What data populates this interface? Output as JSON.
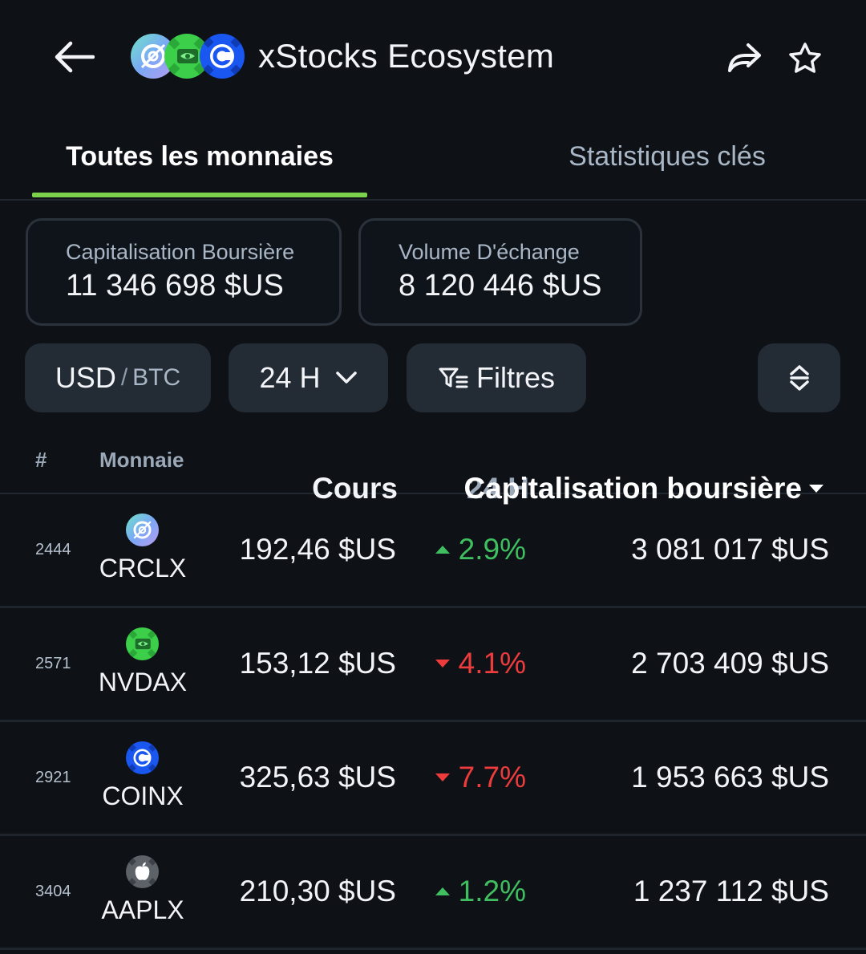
{
  "header": {
    "title": "xStocks Ecosystem",
    "logos": [
      "crclx-logo",
      "nvdax-logo",
      "coinx-logo"
    ],
    "icons": {
      "back": "arrow-left-icon",
      "share": "share-icon",
      "favorite": "star-icon"
    }
  },
  "tabs": [
    {
      "label": "Toutes les monnaies",
      "active": true
    },
    {
      "label": "Statistiques clés",
      "active": false
    }
  ],
  "stats": {
    "market_cap": {
      "label": "Capitalisation Boursière",
      "value": "11 346 698 $US"
    },
    "volume": {
      "label": "Volume D'échange",
      "value": "8 120 446 $US"
    }
  },
  "controls": {
    "currency": {
      "primary": "USD",
      "separator": "/",
      "secondary": "BTC"
    },
    "period": {
      "label": "24 H"
    },
    "filters": {
      "label": "Filtres"
    },
    "sort_icon": "sort-up-down-icon"
  },
  "table": {
    "headers": {
      "rank": "#",
      "coin": "Monnaie",
      "price": "Cours",
      "change": "24 H",
      "market_cap": "Capitalisation boursière"
    },
    "rows": [
      {
        "rank": "2444",
        "symbol": "CRCLX",
        "price": "192,46 $US",
        "change": "2.9%",
        "direction": "up",
        "market_cap": "3 081 017 $US"
      },
      {
        "rank": "2571",
        "symbol": "NVDAX",
        "price": "153,12 $US",
        "change": "4.1%",
        "direction": "down",
        "market_cap": "2 703 409 $US"
      },
      {
        "rank": "2921",
        "symbol": "COINX",
        "price": "325,63 $US",
        "change": "7.7%",
        "direction": "down",
        "market_cap": "1 953 663 $US"
      },
      {
        "rank": "3404",
        "symbol": "AAPLX",
        "price": "210,30 $US",
        "change": "1.2%",
        "direction": "up",
        "market_cap": "1 237 112 $US"
      }
    ]
  },
  "colors": {
    "background": "#0e1217",
    "accent": "#7bd14b",
    "up": "#3fbf5f",
    "down": "#ee3b3b",
    "pill": "#232b35"
  }
}
